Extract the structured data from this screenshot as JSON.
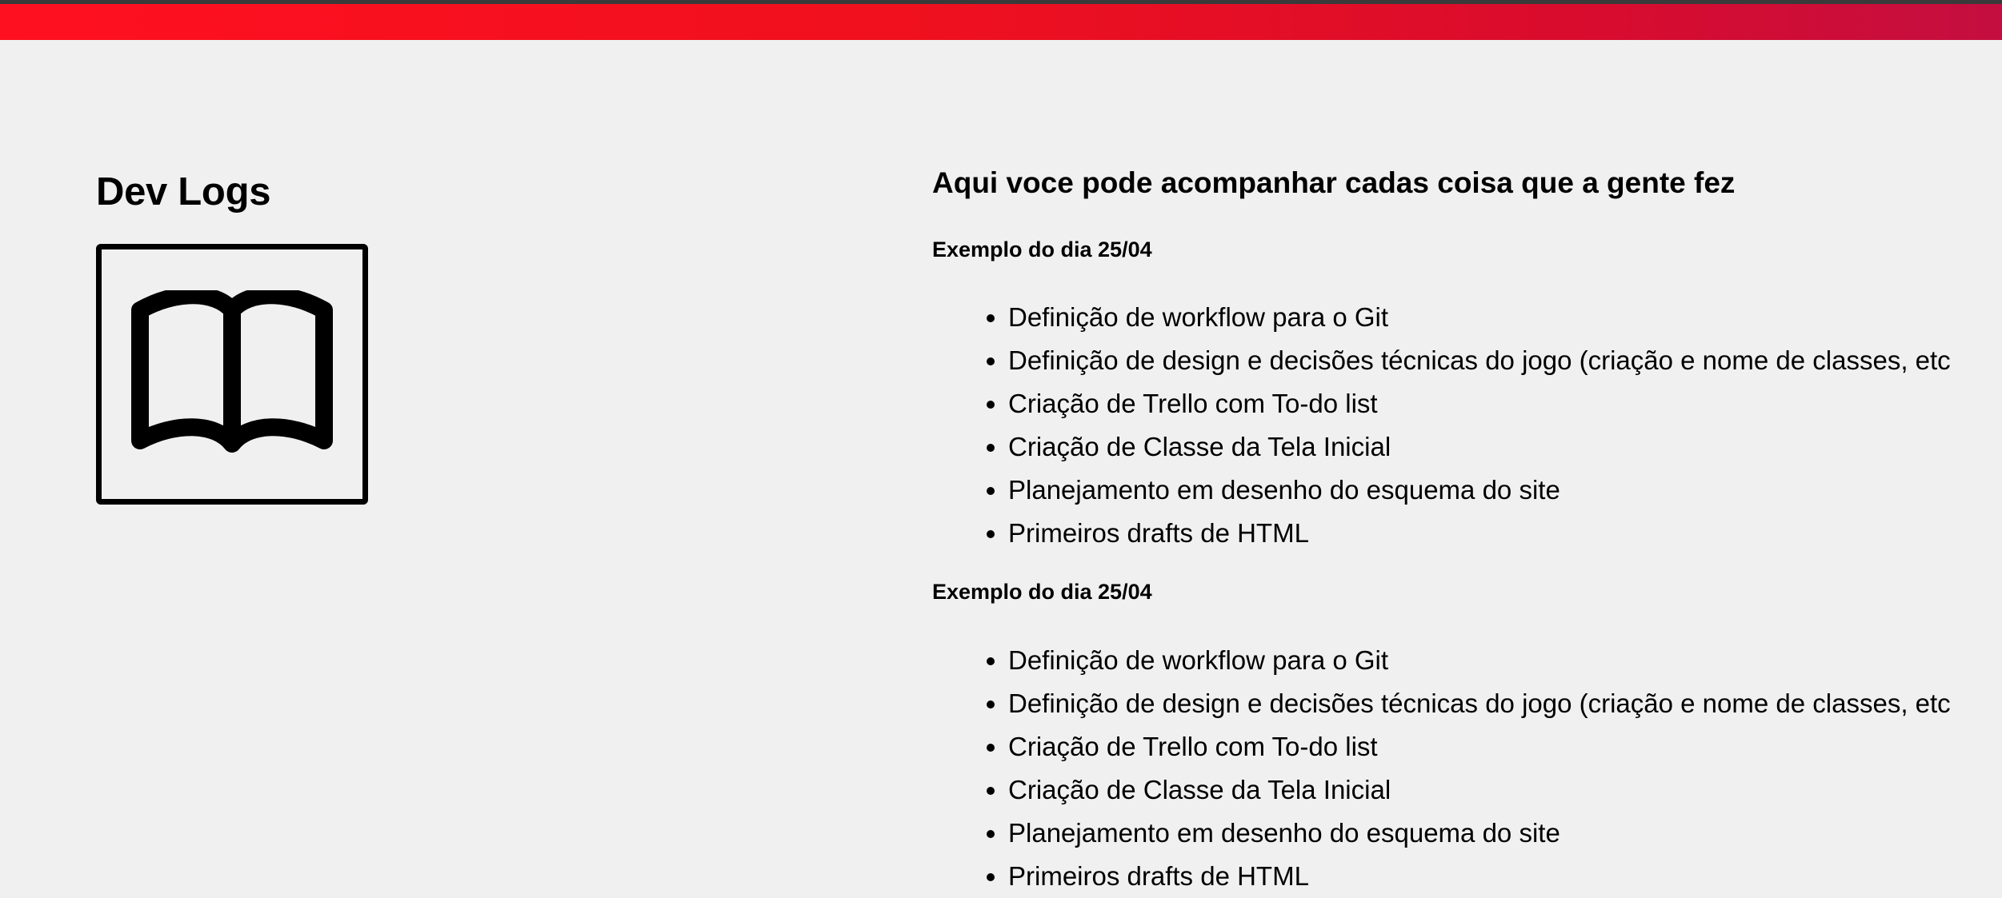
{
  "colors": {
    "banner_start": "#ff1020",
    "banner_end": "#c40e40",
    "background": "#f0f0f0",
    "text": "#000000"
  },
  "left": {
    "title": "Dev Logs",
    "icon": "open-book-icon"
  },
  "main": {
    "heading": "Aqui voce pode acompanhar cadas coisa que a gente fez",
    "logs": [
      {
        "title": "Exemplo do dia 25/04",
        "items": [
          "Definição de workflow para o Git",
          "Definição de design e decisões técnicas do jogo (criação e nome de classes, etc",
          "Criação de Trello com To-do list",
          "Criação de Classe da Tela Inicial",
          "Planejamento em desenho do esquema do site",
          "Primeiros drafts de HTML"
        ]
      },
      {
        "title": "Exemplo do dia 25/04",
        "items": [
          "Definição de workflow para o Git",
          "Definição de design e decisões técnicas do jogo (criação e nome de classes, etc",
          "Criação de Trello com To-do list",
          "Criação de Classe da Tela Inicial",
          "Planejamento em desenho do esquema do site",
          "Primeiros drafts de HTML"
        ]
      }
    ]
  }
}
